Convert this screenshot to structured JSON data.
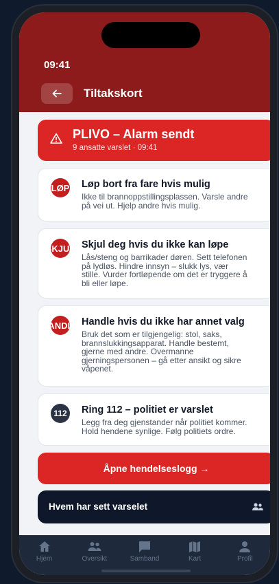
{
  "status_bar": {
    "time": "09:41"
  },
  "header": {
    "title": "Tiltakskort",
    "back_icon": "arrow-left-icon"
  },
  "alarm": {
    "title": "PLIVO – Alarm sendt",
    "subtitle": "9 ansatte varslet · 09:41",
    "icon": "warning-icon",
    "color": "#dc2626"
  },
  "cards": [
    {
      "badge": "LØP",
      "title": "Løp bort fra fare hvis mulig",
      "lines": [
        "Ikke til brannoppstillingsplassen. Varsle andre",
        "på vei ut. Hjelp andre hvis mulig."
      ]
    },
    {
      "badge": "SKJUL",
      "title": "Skjul deg hvis du ikke kan løpe",
      "lines": [
        "Lås/steng og barrikader døren. Sett telefonen",
        "på lydløs. Hindre innsyn – slukk lys, vær",
        "stille. Vurder fortløpende om det er tryggere å",
        "bli eller løpe."
      ]
    },
    {
      "badge": "HANDLE",
      "title": "Handle hvis du ikke har annet valg",
      "lines": [
        "Bruk det som er tilgjengelig: stol, saks,",
        "brannslukkingsapparat. Handle bestemt,",
        "gjerne med andre. Overmanne",
        "gjerningspersonen – gå etter ansikt og sikre",
        "våpenet."
      ]
    },
    {
      "badge": "112",
      "title": "Ring 112 – politiet er varslet",
      "lines": [
        "Legg fra deg gjenstander når politiet kommer.",
        "Hold hendene synlige. Følg politiets ordre."
      ]
    }
  ],
  "actions": {
    "open_log": "Åpne hendelseslogg →",
    "who_seen": "Hvem har sett varselet",
    "who_seen_icon": "people-icon"
  },
  "tabbar": [
    {
      "label": "Hjem",
      "icon": "home-icon"
    },
    {
      "label": "Oversikt",
      "icon": "people-icon"
    },
    {
      "label": "Samband",
      "icon": "chat-icon"
    },
    {
      "label": "Kart",
      "icon": "map-icon"
    },
    {
      "label": "Profil",
      "icon": "user-icon"
    }
  ],
  "colors": {
    "header": "#8e1b1b",
    "accent": "#dc2626",
    "dark_button": "#0f172a",
    "tabbar": "#1e293b"
  }
}
